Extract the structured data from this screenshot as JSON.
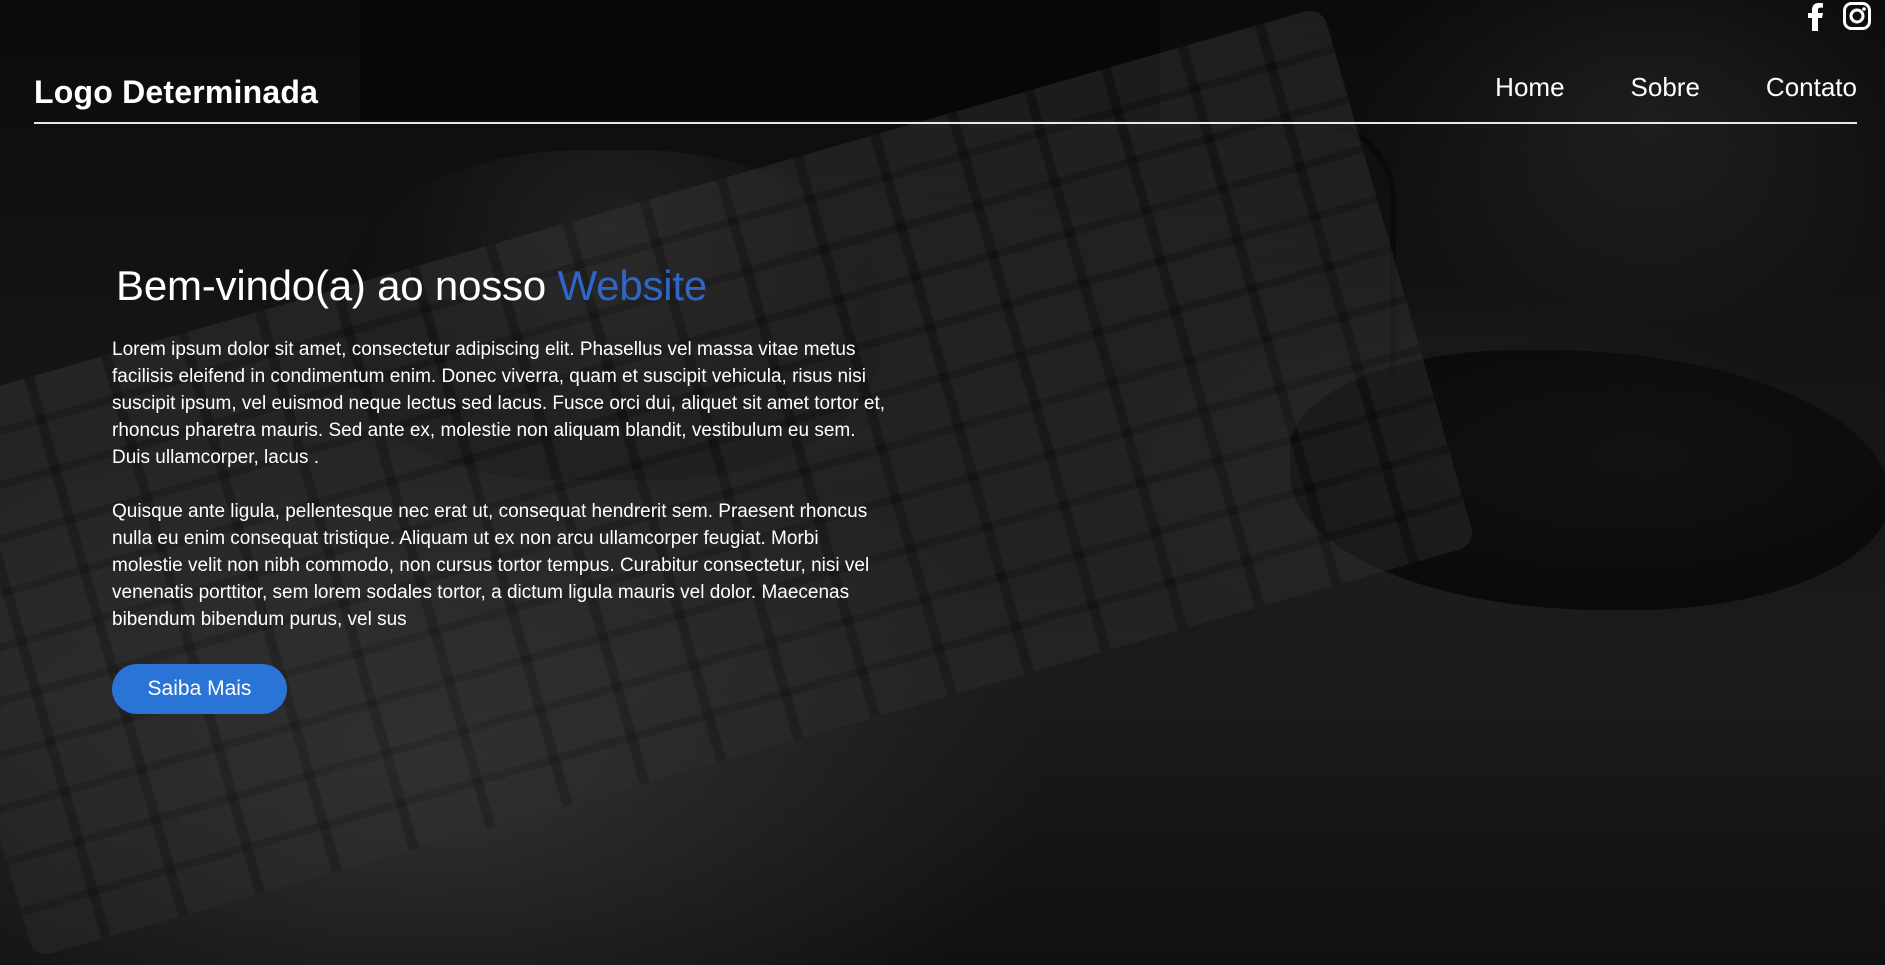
{
  "social": {
    "icons": [
      {
        "name": "facebook-icon",
        "glyph": "f"
      },
      {
        "name": "instagram-icon",
        "glyph": ""
      }
    ]
  },
  "header": {
    "logo": "Logo Determinada",
    "nav": [
      "Home",
      "Sobre",
      "Contato"
    ]
  },
  "hero": {
    "title_prefix": "Bem-vindo(a) ao nosso ",
    "title_accent": "Website",
    "paragraph1": "Lorem ipsum dolor sit amet, consectetur adipiscing elit. Phasellus vel massa vitae metus facilisis eleifend in condimentum enim. Donec viverra, quam et suscipit vehicula, risus nisi suscipit ipsum, vel euismod neque lectus sed lacus. Fusce orci dui, aliquet sit amet tortor et, rhoncus pharetra mauris. Sed ante ex, molestie non aliquam blandit, vestibulum eu sem. Duis ullamcorper, lacus .",
    "paragraph2": "Quisque ante ligula, pellentesque nec erat ut, consequat hendrerit sem. Praesent rhoncus nulla eu enim consequat tristique. Aliquam ut ex non arcu ullamcorper feugiat. Morbi molestie velit non nibh commodo, non cursus tortor tempus. Curabitur consectetur, nisi vel venenatis porttitor, sem lorem sodales tortor, a dictum ligula mauris vel dolor. Maecenas bibendum bibendum purus, vel sus",
    "cta_label": "Saiba Mais"
  },
  "colors": {
    "accent": "#2f66c8",
    "button": "#2a73d7",
    "text": "#ffffff"
  }
}
